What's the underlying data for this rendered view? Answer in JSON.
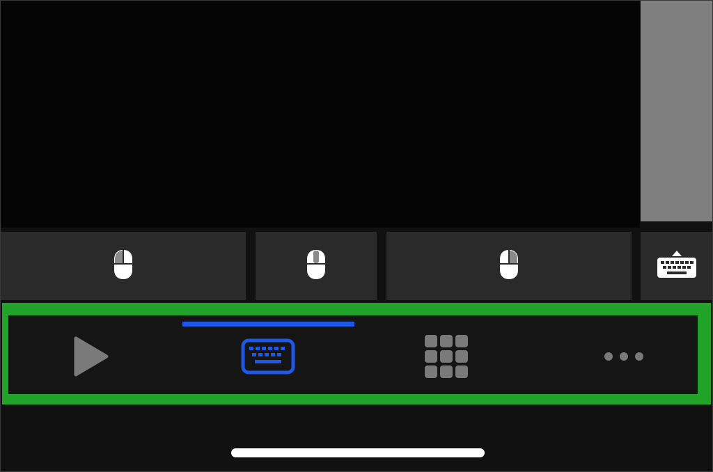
{
  "trackpad": {
    "scroll_indicator": "scroll-bar"
  },
  "mouse_buttons": [
    {
      "name": "left-click",
      "icon": "mouse-left-icon"
    },
    {
      "name": "middle-click",
      "icon": "mouse-middle-icon"
    },
    {
      "name": "right-click",
      "icon": "mouse-right-icon"
    }
  ],
  "keyboard_toggle": {
    "icon": "keyboard-show-icon"
  },
  "toolbar": {
    "active_tab": "keyboard",
    "tabs": [
      {
        "id": "play",
        "icon": "play-icon",
        "active": false
      },
      {
        "id": "keyboard",
        "icon": "keyboard-icon",
        "active": true
      },
      {
        "id": "keypad",
        "icon": "keypad-grid-icon",
        "active": false
      },
      {
        "id": "more",
        "icon": "more-dots-icon",
        "active": false
      }
    ]
  },
  "colors": {
    "background": "#111111",
    "trackpad": "#050505",
    "button": "#2a2a2a",
    "scroll_strip": "#7f7f7f",
    "accent": "#1f57e6",
    "highlight_frame": "#21a32a",
    "inactive_icon": "#7a7a7a",
    "icon_white": "#ffffff"
  }
}
